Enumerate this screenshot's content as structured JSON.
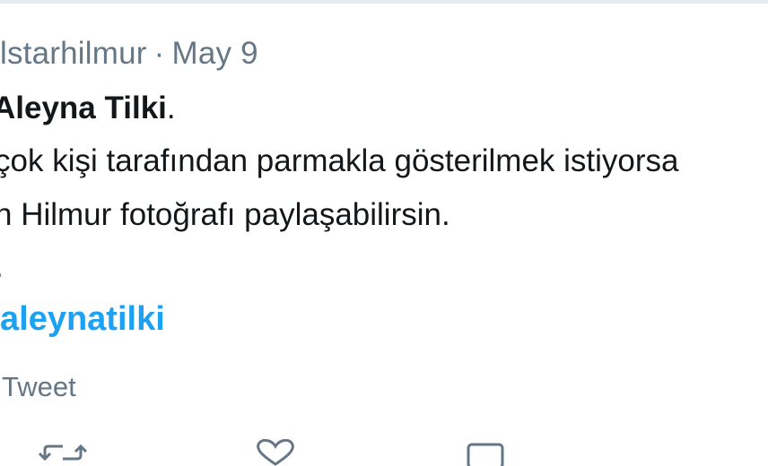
{
  "tweet": {
    "handle": "lstarhilmur",
    "separator": "·",
    "date": "May 9",
    "mention": "Aleyna Tilki",
    "mention_suffix": ".",
    "lines": [
      "çok kişi tarafından parmakla gösterilmek istiyorsa",
      "n Hilmur fotoğrafı paylaşabilirsin.",
      "."
    ],
    "hashtag": "aleynatilki",
    "translate_label": "Tweet"
  },
  "icons": {
    "retweet": "retweet-icon",
    "like": "heart-icon",
    "share": "share-icon"
  },
  "colors": {
    "link": "#1da1f2",
    "secondary_text": "#657786",
    "primary_text": "#14171a"
  }
}
